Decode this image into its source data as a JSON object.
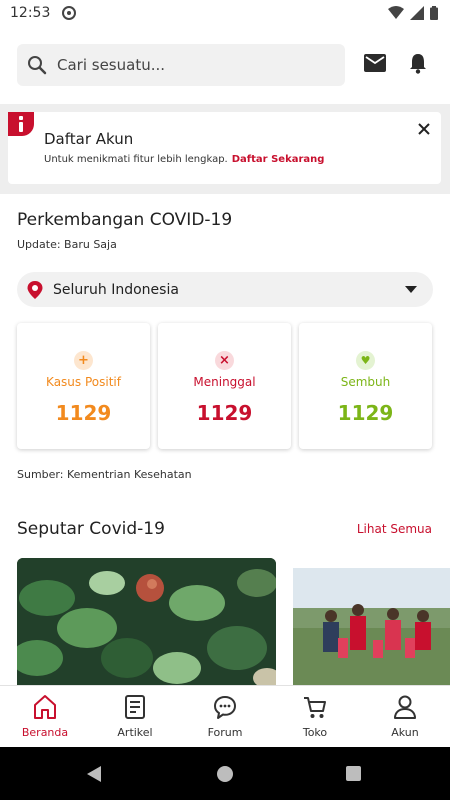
{
  "status_bar": {
    "time": "12:53",
    "icons": [
      "app-notification-icon",
      "wifi-icon",
      "signal-icon",
      "battery-icon"
    ]
  },
  "header": {
    "search_placeholder": "Cari sesuatu...",
    "icons": [
      "search-icon",
      "mail-icon",
      "bell-icon"
    ]
  },
  "banner": {
    "title": "Daftar Akun",
    "subtitle": "Untuk menikmati fitur lebih lengkap.",
    "link": "Daftar Sekarang",
    "icons": [
      "info-icon",
      "close-icon"
    ]
  },
  "covid": {
    "title": "Perkembangan COVID-19",
    "update": "Update: Baru Saja",
    "region": "Seluruh Indonesia",
    "stats": [
      {
        "label": "Kasus Positif",
        "value": "1129",
        "icon": "+",
        "color": "#f28a1e",
        "bg": "#fde6cf"
      },
      {
        "label": "Meninggal",
        "value": "1129",
        "icon": "×",
        "color": "#c8102e",
        "bg": "#f9d9dc"
      },
      {
        "label": "Sembuh",
        "value": "1129",
        "icon": "♥",
        "color": "#7cb518",
        "bg": "#e4f3d2"
      }
    ],
    "source": "Sumber: Kementrian Kesehatan"
  },
  "news": {
    "title": "Seputar Covid-19",
    "see_all": "Lihat Semua"
  },
  "bottom_nav": [
    {
      "label": "Beranda",
      "icon": "home-icon",
      "active": true
    },
    {
      "label": "Artikel",
      "icon": "article-icon",
      "active": false
    },
    {
      "label": "Forum",
      "icon": "forum-icon",
      "active": false
    },
    {
      "label": "Toko",
      "icon": "cart-icon",
      "active": false
    },
    {
      "label": "Akun",
      "icon": "user-icon",
      "active": false
    }
  ],
  "colors": {
    "accent": "#c8102e",
    "positive": "#f28a1e",
    "death": "#c8102e",
    "recovered": "#7cb518"
  }
}
